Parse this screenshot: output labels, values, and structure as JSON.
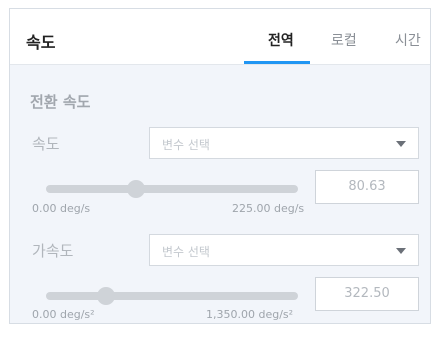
{
  "panel": {
    "title": "속도",
    "tabs": [
      {
        "label": "전역",
        "active": true
      },
      {
        "label": "로컬",
        "active": false
      },
      {
        "label": "시간",
        "active": false
      }
    ],
    "accent_color": "#2196f3"
  },
  "section": {
    "title": "전환 속도",
    "fields": [
      {
        "label": "속도",
        "select_placeholder": "변수 선택",
        "slider_fraction": 0.3583,
        "range_min": "0.00 deg/s",
        "range_max": "225.00 deg/s",
        "value": "80.63"
      },
      {
        "label": "가속도",
        "select_placeholder": "변수 선택",
        "slider_fraction": 0.2389,
        "range_min": "0.00 deg/s²",
        "range_max": "1,350.00 deg/s²",
        "value": "322.50"
      }
    ]
  }
}
